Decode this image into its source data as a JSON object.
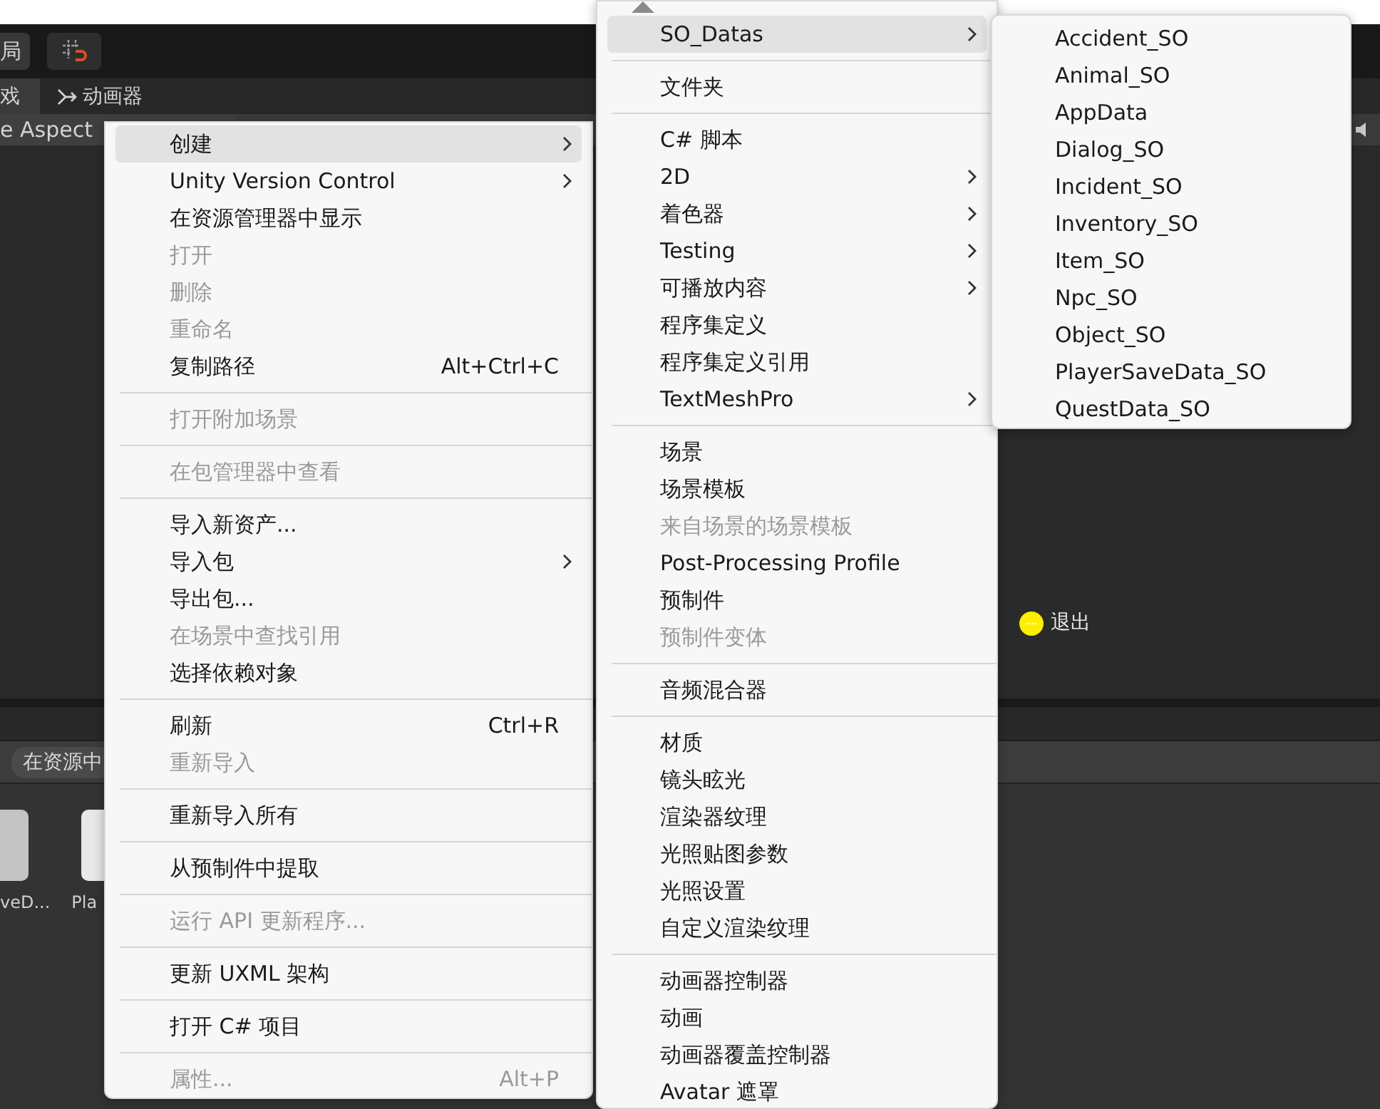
{
  "toolbar": {
    "layout_button": "局"
  },
  "tabs": [
    {
      "label": "戏",
      "selected": true
    },
    {
      "label": "动画器",
      "selected": false
    }
  ],
  "game_view": {
    "aspect": "e Aspect",
    "hint": "退出"
  },
  "project": {
    "search_scope": "在资源中",
    "assets": [
      {
        "label": "veD..."
      },
      {
        "label": "Pla"
      }
    ]
  },
  "menus": [
    {
      "items": [
        {
          "kind": "item",
          "label": "创建",
          "submenu": true,
          "disabled": false,
          "selected": true
        },
        {
          "kind": "item",
          "label": "Unity Version Control",
          "submenu": true,
          "disabled": false,
          "selected": false
        },
        {
          "kind": "item",
          "label": "在资源管理器中显示",
          "submenu": false,
          "disabled": false,
          "selected": false
        },
        {
          "kind": "item",
          "label": "打开",
          "submenu": false,
          "disabled": true,
          "selected": false
        },
        {
          "kind": "item",
          "label": "删除",
          "submenu": false,
          "disabled": true,
          "selected": false
        },
        {
          "kind": "item",
          "label": "重命名",
          "submenu": false,
          "disabled": true,
          "selected": false
        },
        {
          "kind": "item",
          "label": "复制路径",
          "shortcut": "Alt+Ctrl+C",
          "submenu": false,
          "disabled": false,
          "selected": false
        },
        {
          "kind": "separator"
        },
        {
          "kind": "item",
          "label": "打开附加场景",
          "submenu": false,
          "disabled": true,
          "selected": false
        },
        {
          "kind": "separator"
        },
        {
          "kind": "item",
          "label": "在包管理器中查看",
          "submenu": false,
          "disabled": true,
          "selected": false
        },
        {
          "kind": "separator"
        },
        {
          "kind": "item",
          "label": "导入新资产...",
          "submenu": false,
          "disabled": false,
          "selected": false
        },
        {
          "kind": "item",
          "label": "导入包",
          "submenu": true,
          "disabled": false,
          "selected": false
        },
        {
          "kind": "item",
          "label": "导出包...",
          "submenu": false,
          "disabled": false,
          "selected": false
        },
        {
          "kind": "item",
          "label": "在场景中查找引用",
          "submenu": false,
          "disabled": true,
          "selected": false
        },
        {
          "kind": "item",
          "label": "选择依赖对象",
          "submenu": false,
          "disabled": false,
          "selected": false
        },
        {
          "kind": "separator"
        },
        {
          "kind": "item",
          "label": "刷新",
          "shortcut": "Ctrl+R",
          "submenu": false,
          "disabled": false,
          "selected": false
        },
        {
          "kind": "item",
          "label": "重新导入",
          "submenu": false,
          "disabled": true,
          "selected": false
        },
        {
          "kind": "separator"
        },
        {
          "kind": "item",
          "label": "重新导入所有",
          "submenu": false,
          "disabled": false,
          "selected": false
        },
        {
          "kind": "separator"
        },
        {
          "kind": "item",
          "label": "从预制件中提取",
          "submenu": false,
          "disabled": false,
          "selected": false
        },
        {
          "kind": "separator"
        },
        {
          "kind": "item",
          "label": "运行 API 更新程序...",
          "submenu": false,
          "disabled": true,
          "selected": false
        },
        {
          "kind": "separator"
        },
        {
          "kind": "item",
          "label": "更新 UXML 架构",
          "submenu": false,
          "disabled": false,
          "selected": false
        },
        {
          "kind": "separator"
        },
        {
          "kind": "item",
          "label": "打开 C# 项目",
          "submenu": false,
          "disabled": false,
          "selected": false
        },
        {
          "kind": "separator"
        },
        {
          "kind": "item",
          "label": "属性...",
          "shortcut": "Alt+P",
          "submenu": false,
          "disabled": true,
          "selected": false
        }
      ]
    },
    {
      "items": [
        {
          "kind": "item",
          "label": "SO_Datas",
          "submenu": true,
          "disabled": false,
          "selected": true
        },
        {
          "kind": "separator"
        },
        {
          "kind": "item",
          "label": "文件夹",
          "submenu": false,
          "disabled": false,
          "selected": false
        },
        {
          "kind": "separator"
        },
        {
          "kind": "item",
          "label": "C# 脚本",
          "submenu": false,
          "disabled": false,
          "selected": false
        },
        {
          "kind": "item",
          "label": "2D",
          "submenu": true,
          "disabled": false,
          "selected": false
        },
        {
          "kind": "item",
          "label": "着色器",
          "submenu": true,
          "disabled": false,
          "selected": false
        },
        {
          "kind": "item",
          "label": "Testing",
          "submenu": true,
          "disabled": false,
          "selected": false
        },
        {
          "kind": "item",
          "label": "可播放内容",
          "submenu": true,
          "disabled": false,
          "selected": false
        },
        {
          "kind": "item",
          "label": "程序集定义",
          "submenu": false,
          "disabled": false,
          "selected": false
        },
        {
          "kind": "item",
          "label": "程序集定义引用",
          "submenu": false,
          "disabled": false,
          "selected": false
        },
        {
          "kind": "item",
          "label": "TextMeshPro",
          "submenu": true,
          "disabled": false,
          "selected": false
        },
        {
          "kind": "separator"
        },
        {
          "kind": "item",
          "label": "场景",
          "submenu": false,
          "disabled": false,
          "selected": false
        },
        {
          "kind": "item",
          "label": "场景模板",
          "submenu": false,
          "disabled": false,
          "selected": false
        },
        {
          "kind": "item",
          "label": "来自场景的场景模板",
          "submenu": false,
          "disabled": true,
          "selected": false
        },
        {
          "kind": "item",
          "label": "Post-Processing Profile",
          "submenu": false,
          "disabled": false,
          "selected": false
        },
        {
          "kind": "item",
          "label": "预制件",
          "submenu": false,
          "disabled": false,
          "selected": false
        },
        {
          "kind": "item",
          "label": "预制件变体",
          "submenu": false,
          "disabled": true,
          "selected": false
        },
        {
          "kind": "separator"
        },
        {
          "kind": "item",
          "label": "音频混合器",
          "submenu": false,
          "disabled": false,
          "selected": false
        },
        {
          "kind": "separator"
        },
        {
          "kind": "item",
          "label": "材质",
          "submenu": false,
          "disabled": false,
          "selected": false
        },
        {
          "kind": "item",
          "label": "镜头眩光",
          "submenu": false,
          "disabled": false,
          "selected": false
        },
        {
          "kind": "item",
          "label": "渲染器纹理",
          "submenu": false,
          "disabled": false,
          "selected": false
        },
        {
          "kind": "item",
          "label": "光照贴图参数",
          "submenu": false,
          "disabled": false,
          "selected": false
        },
        {
          "kind": "item",
          "label": "光照设置",
          "submenu": false,
          "disabled": false,
          "selected": false
        },
        {
          "kind": "item",
          "label": "自定义渲染纹理",
          "submenu": false,
          "disabled": false,
          "selected": false
        },
        {
          "kind": "separator"
        },
        {
          "kind": "item",
          "label": "动画器控制器",
          "submenu": false,
          "disabled": false,
          "selected": false
        },
        {
          "kind": "item",
          "label": "动画",
          "submenu": false,
          "disabled": false,
          "selected": false
        },
        {
          "kind": "item",
          "label": "动画器覆盖控制器",
          "submenu": false,
          "disabled": false,
          "selected": false
        },
        {
          "kind": "item",
          "label": "Avatar 遮罩",
          "submenu": false,
          "disabled": false,
          "selected": false
        }
      ]
    },
    {
      "items": [
        {
          "kind": "item",
          "label": "Accident_SO",
          "submenu": false,
          "disabled": false,
          "selected": false
        },
        {
          "kind": "item",
          "label": "Animal_SO",
          "submenu": false,
          "disabled": false,
          "selected": false
        },
        {
          "kind": "item",
          "label": "AppData",
          "submenu": false,
          "disabled": false,
          "selected": false
        },
        {
          "kind": "item",
          "label": "Dialog_SO",
          "submenu": false,
          "disabled": false,
          "selected": false
        },
        {
          "kind": "item",
          "label": "Incident_SO",
          "submenu": false,
          "disabled": false,
          "selected": false
        },
        {
          "kind": "item",
          "label": "Inventory_SO",
          "submenu": false,
          "disabled": false,
          "selected": false
        },
        {
          "kind": "item",
          "label": "Item_SO",
          "submenu": false,
          "disabled": false,
          "selected": false
        },
        {
          "kind": "item",
          "label": "Npc_SO",
          "submenu": false,
          "disabled": false,
          "selected": false
        },
        {
          "kind": "item",
          "label": "Object_SO",
          "submenu": false,
          "disabled": false,
          "selected": false
        },
        {
          "kind": "item",
          "label": "PlayerSaveData_SO",
          "submenu": false,
          "disabled": false,
          "selected": false
        },
        {
          "kind": "item",
          "label": "QuestData_SO",
          "submenu": false,
          "disabled": false,
          "selected": false
        }
      ]
    }
  ]
}
